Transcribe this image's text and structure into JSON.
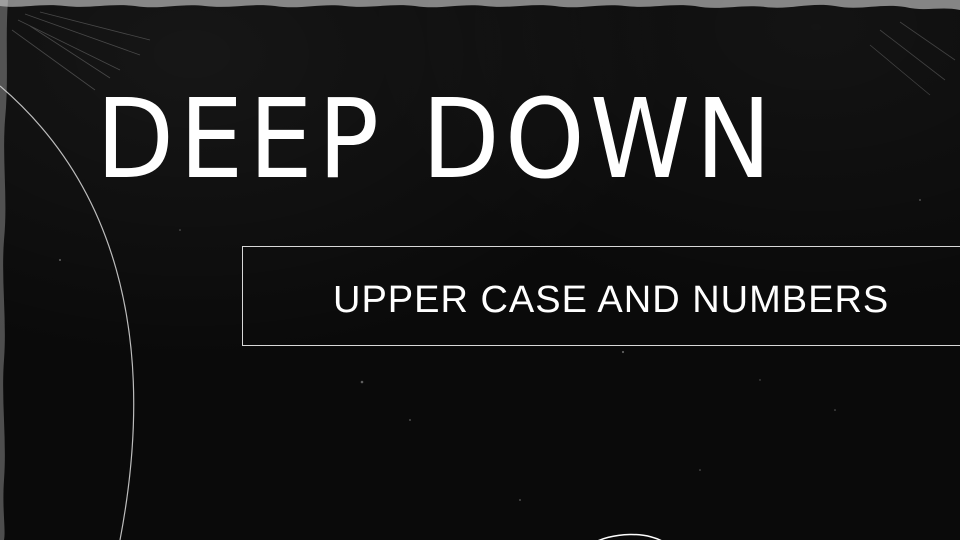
{
  "slide": {
    "title": "DEEP DOWN",
    "subtitle": "UPPER CASE AND NUMBERS"
  },
  "colors": {
    "background": "#0a0a0a",
    "text": "#ffffff",
    "outline": "#d8d8d8"
  }
}
